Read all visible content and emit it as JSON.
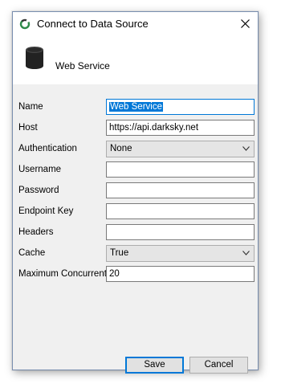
{
  "window": {
    "title": "Connect to Data Source"
  },
  "header": {
    "label": "Web Service",
    "icon": "database-icon"
  },
  "form": {
    "name": {
      "label": "Name",
      "value": "Web Service"
    },
    "host": {
      "label": "Host",
      "value": "https://api.darksky.net"
    },
    "authentication": {
      "label": "Authentication",
      "value": "None"
    },
    "username": {
      "label": "Username",
      "value": ""
    },
    "password": {
      "label": "Password",
      "value": ""
    },
    "endpoint_key": {
      "label": "Endpoint Key",
      "value": ""
    },
    "headers": {
      "label": "Headers",
      "value": ""
    },
    "cache": {
      "label": "Cache",
      "value": "True"
    },
    "max_concurrent": {
      "label": "Maximum Concurrent",
      "value": "20"
    }
  },
  "buttons": {
    "save": "Save",
    "cancel": "Cancel"
  },
  "colors": {
    "accent": "#0078d7",
    "icon_green": "#2f8a4a",
    "body_bg": "#f0f0f0"
  }
}
